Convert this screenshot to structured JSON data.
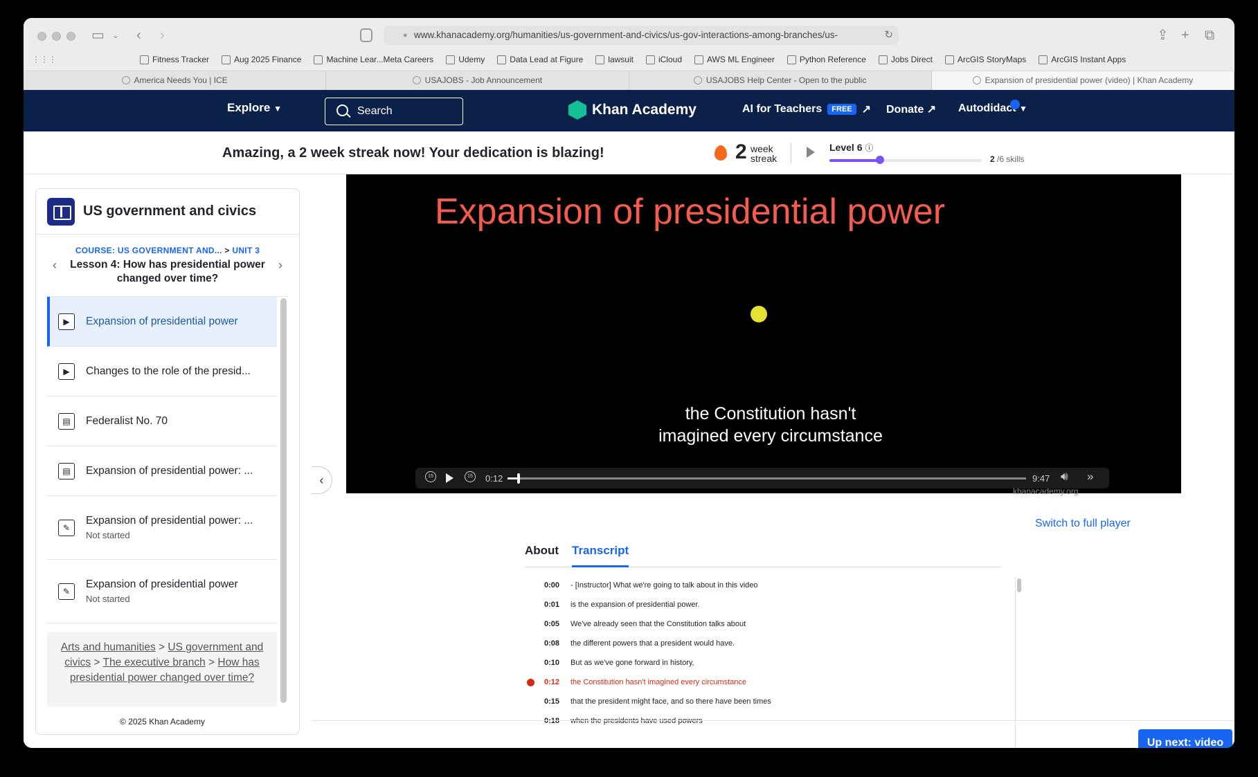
{
  "browser": {
    "url": "www.khanacademy.org/humanities/us-government-and-civics/us-gov-interactions-among-branches/us-",
    "bookmarks": [
      "Fitness Tracker",
      "Aug 2025 Finance",
      "Machine Lear...Meta Careers",
      "Udemy",
      "Data Lead at Figure",
      "lawsuit",
      "iCloud",
      "AWS ML Engineer",
      "Python Reference",
      "Jobs Direct",
      "ArcGIS StoryMaps",
      "ArcGIS Instant Apps"
    ],
    "tabs": [
      "America Needs You | ICE",
      "USAJOBS - Job Announcement",
      "USAJOBS Help Center - Open to the public",
      "Expansion of presidential power (video) | Khan Academy"
    ]
  },
  "nav": {
    "explore": "Explore",
    "search_placeholder": "Search",
    "logo": "Khan Academy",
    "ai_teachers": "AI for Teachers",
    "free_badge": "FREE",
    "donate": "Donate",
    "user": "Autodidact"
  },
  "streak": {
    "message": "Amazing, a 2 week streak now! Your dedication is blazing!",
    "count": "2",
    "unit_top": "week",
    "unit_bottom": "streak",
    "level": "Level 6",
    "level_progress": 0.33,
    "skills_done": "2",
    "skills_total": "/6 skills"
  },
  "sidebar": {
    "title": "US government and civics",
    "course": "COURSE: US GOVERNMENT AND...",
    "unit": "UNIT 3",
    "lesson": "Lesson 4: How has presidential power changed over time?",
    "items": [
      {
        "label": "Expansion of presidential power",
        "sub": "",
        "icon": "play-icon"
      },
      {
        "label": "Changes to the role of the presid...",
        "sub": "",
        "icon": "play-icon"
      },
      {
        "label": "Federalist No. 70",
        "sub": "",
        "icon": "article-icon"
      },
      {
        "label": "Expansion of presidential power: ...",
        "sub": "",
        "icon": "article-icon"
      },
      {
        "label": "Expansion of presidential power: ...",
        "sub": "Not started",
        "icon": "pencil-icon"
      },
      {
        "label": "Expansion of presidential power",
        "sub": "Not started",
        "icon": "pencil-icon"
      }
    ],
    "breadcrumbs": [
      "Arts and humanities",
      "US government and civics",
      "The executive branch",
      "How has presidential power changed over time?"
    ],
    "copyright": "© 2025 Khan Academy"
  },
  "video": {
    "title": "Expansion of presidential power",
    "caption_line1": "the Constitution hasn't",
    "caption_line2": "imagined every circumstance",
    "current_time": "0:12",
    "duration": "9:47",
    "progress": 0.02,
    "watermark": "khanacademy.org",
    "switch_player": "Switch to full player"
  },
  "transcript": {
    "tab_about": "About",
    "tab_transcript": "Transcript",
    "lines": [
      {
        "time": "0:00",
        "text": "- [Instructor] What we're going to talk about in this video"
      },
      {
        "time": "0:01",
        "text": "is the expansion of presidential power."
      },
      {
        "time": "0:05",
        "text": "We've already seen that the Constitution talks about"
      },
      {
        "time": "0:08",
        "text": "the different powers that a president would have."
      },
      {
        "time": "0:10",
        "text": "But as we've gone forward in history,"
      },
      {
        "time": "0:12",
        "text": "the Constitution hasn't imagined every circumstance"
      },
      {
        "time": "0:15",
        "text": "that the president might face, and so there have been times"
      },
      {
        "time": "0:18",
        "text": "when the presidents have used powers"
      }
    ],
    "current_index": 5
  },
  "up_next": "Up next: video",
  "colors": {
    "nav_bg": "#0b2149",
    "accent": "#1865f2",
    "title_red": "#f55b4e",
    "current_red": "#d92916",
    "level_purple": "#7854f7"
  }
}
